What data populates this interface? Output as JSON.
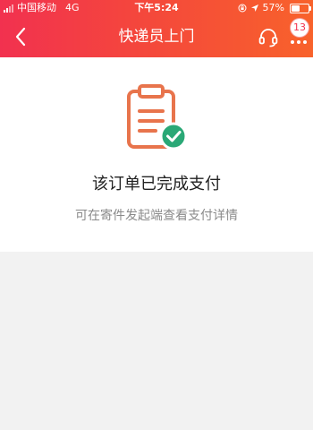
{
  "status_bar": {
    "carrier": "中国移动",
    "network": "4G",
    "time": "下午5:24",
    "battery_percent": "57%",
    "battery_level": 0.57,
    "icons": [
      "signal-icon",
      "orientation-lock-icon",
      "location-icon",
      "battery-icon"
    ]
  },
  "header": {
    "title": "快递员上门",
    "back_icon": "chevron-left-icon",
    "support_icon": "headset-icon",
    "more_icon": "more-dots-icon",
    "badge_count": "13",
    "colors": {
      "gradient_start": "#f2314f",
      "gradient_end": "#f8622b",
      "text": "#ffffff"
    }
  },
  "status": {
    "icon": "clipboard-check-icon",
    "title": "该订单已完成支付",
    "description": "可在寄件发起端查看支付详情",
    "colors": {
      "clipboard": "#e8744c",
      "check_badge": "#2aa876"
    }
  },
  "page": {
    "background": "#f2f2f2"
  }
}
